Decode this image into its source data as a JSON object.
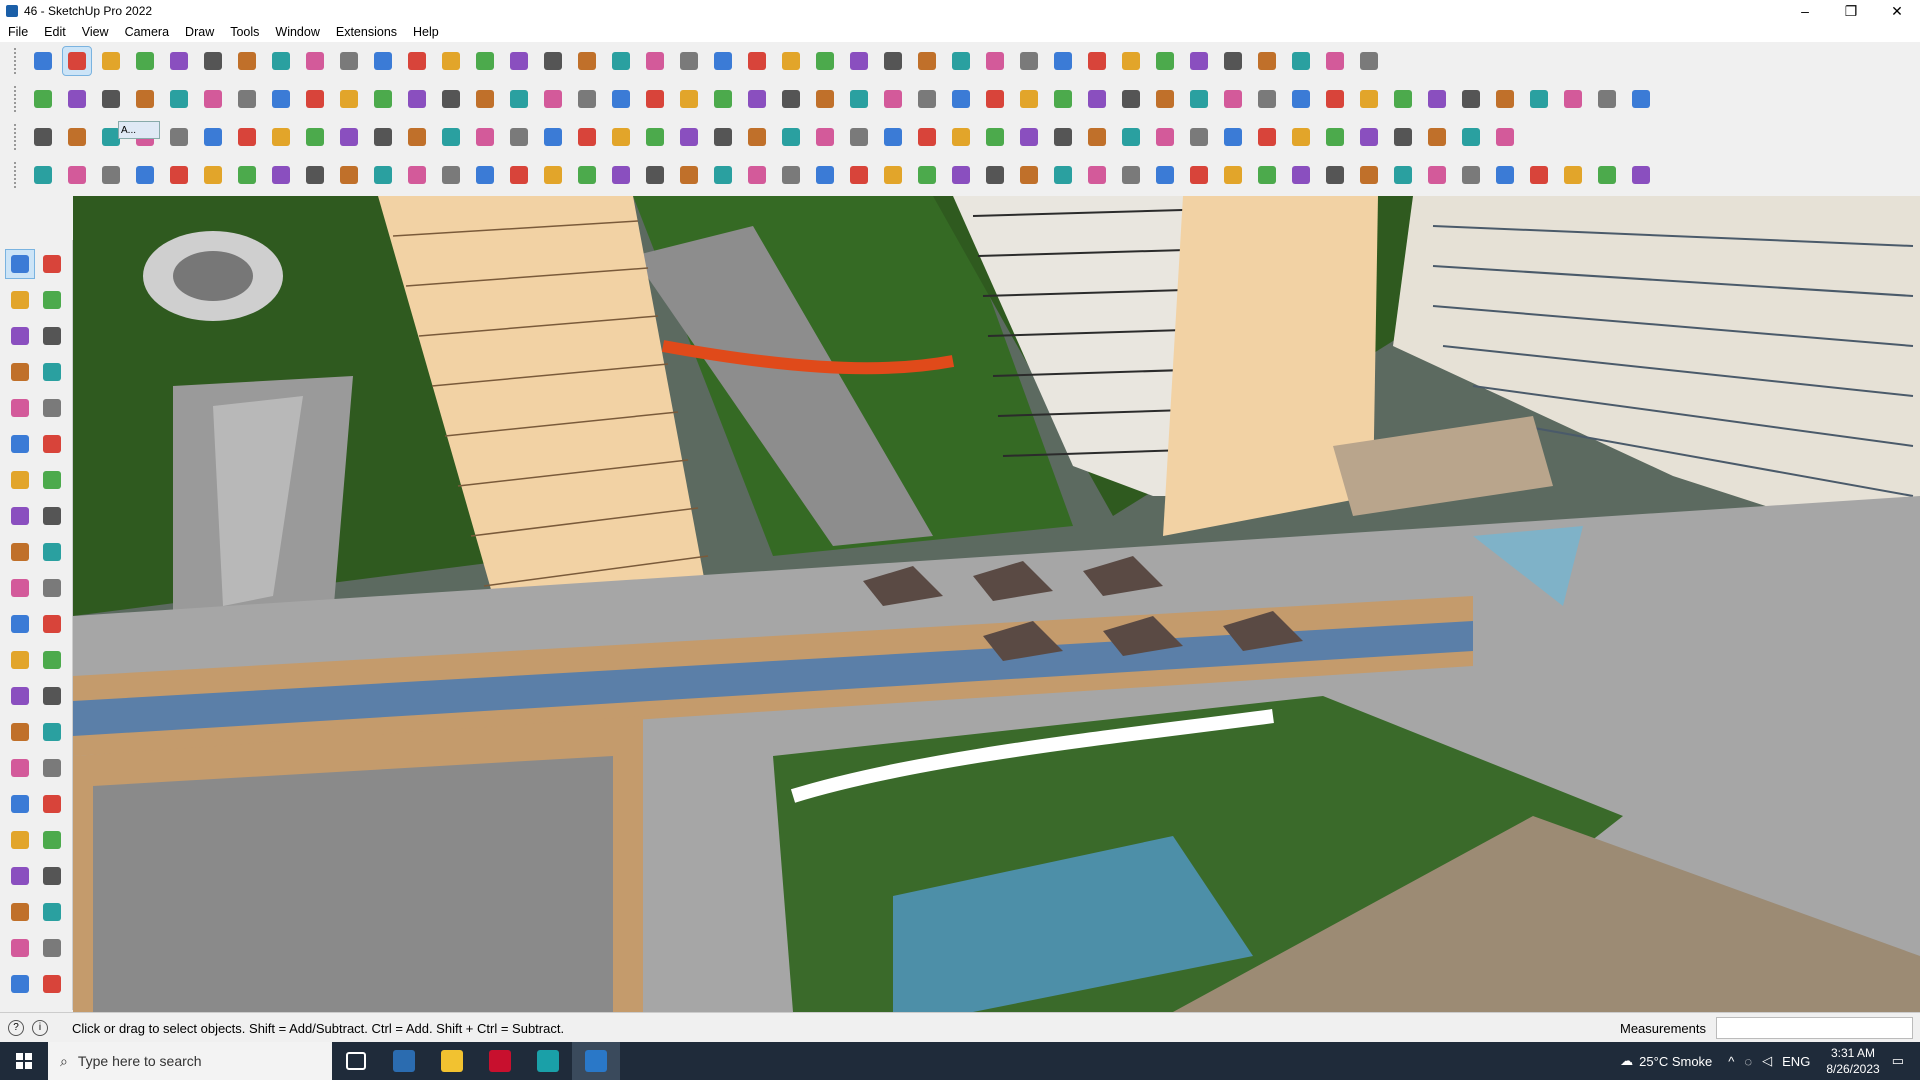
{
  "window": {
    "title": "46 - SketchUp Pro 2022",
    "minimize": "–",
    "maximize": "❐",
    "close": "✕"
  },
  "menu": [
    "File",
    "Edit",
    "View",
    "Camera",
    "Draw",
    "Tools",
    "Window",
    "Extensions",
    "Help"
  ],
  "status": {
    "hint": "Click or drag to select objects. Shift = Add/Subtract. Ctrl = Add. Shift + Ctrl = Subtract.",
    "measurements_label": "Measurements",
    "measurements_value": ""
  },
  "taskbar": {
    "search_placeholder": "Type here to search",
    "weather": "25°C  Smoke",
    "language": "ENG",
    "time": "3:31 AM",
    "date": "8/26/2023"
  },
  "tooltip_popup": "A...",
  "colors": {
    "titlebar": "#ffffff",
    "toolbar": "#f0f0f0",
    "taskbar": "#1f2b3a",
    "grass": "#2f5a1f",
    "tower": "#f2d2a4",
    "paving": "#9a9a9a",
    "red_walkway": "#e04a1a"
  }
}
